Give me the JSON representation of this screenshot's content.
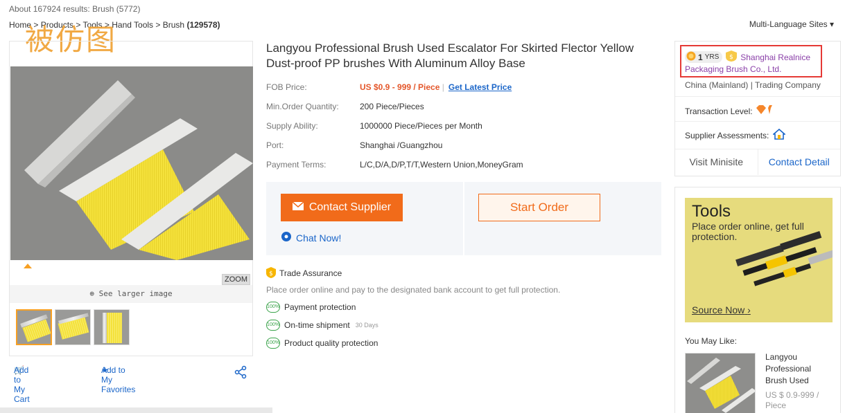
{
  "results": {
    "text": "About 167924 results:",
    "category": "Brush (5772)"
  },
  "breadcrumb": {
    "home": "Home",
    "products": "Products",
    "tools": "Tools",
    "hand_tools": "Hand Tools",
    "brush": "Brush",
    "count": "(129578)"
  },
  "watermark": "被仿图",
  "multi_language": "Multi-Language Sites",
  "gallery": {
    "zoom": "ZOOM",
    "see_larger": "See larger image",
    "thumb_count": 3
  },
  "actions_left": {
    "add_cart": "Add to My Cart",
    "add_favorites": "Add to My Favorites"
  },
  "product": {
    "title": "Langyou Professional Brush Used Escalator For Skirted Flector Yellow Dust-proof PP brushes With Aluminum Alloy Base",
    "props": [
      {
        "label": "FOB Price:",
        "value": "US $0.9 - 999 / Piece"
      },
      {
        "label": "Min.Order Quantity:",
        "value": "200 Piece/Pieces"
      },
      {
        "label": "Supply Ability:",
        "value": "1000000 Piece/Pieces per Month"
      },
      {
        "label": "Port:",
        "value": "Shanghai /Guangzhou"
      },
      {
        "label": "Payment Terms:",
        "value": "L/C,D/A,D/P,T/T,Western Union,MoneyGram"
      }
    ],
    "latest_price": "Get Latest Price"
  },
  "buttons": {
    "contact_supplier": "Contact Supplier",
    "start_order": "Start Order",
    "chat_now": "Chat Now!"
  },
  "trade": {
    "title": "Trade Assurance",
    "desc": "Place order online and pay to the designated bank account to get full protection.",
    "items": [
      {
        "label": "Payment protection",
        "note": ""
      },
      {
        "label": "On-time shipment",
        "note": "30 Days"
      },
      {
        "label": "Product quality protection",
        "note": ""
      }
    ],
    "pct": "100%"
  },
  "supplier": {
    "years": "1",
    "yrs": "YRS",
    "name1": "Shanghai Realnice",
    "name2": "Packaging Brush Co., Ltd.",
    "location": "China (Mainland) | Trading Company",
    "transaction_level": "Transaction Level:",
    "assessments": "Supplier Assessments:",
    "visit": "Visit Minisite",
    "contact": "Contact Detail"
  },
  "ad": {
    "title": "Tools",
    "subtitle": "Place order online, get full protection.",
    "source": "Source Now"
  },
  "you_may_like": {
    "label": "You May Like:",
    "title": "Langyou Professional Brush Used",
    "price": "US $ 0.9-999 / Piece"
  },
  "colors": {
    "accent": "#f16b1a",
    "link": "#1b66c9",
    "supplier": "#8a3fa8",
    "highlight": "#e53935"
  }
}
